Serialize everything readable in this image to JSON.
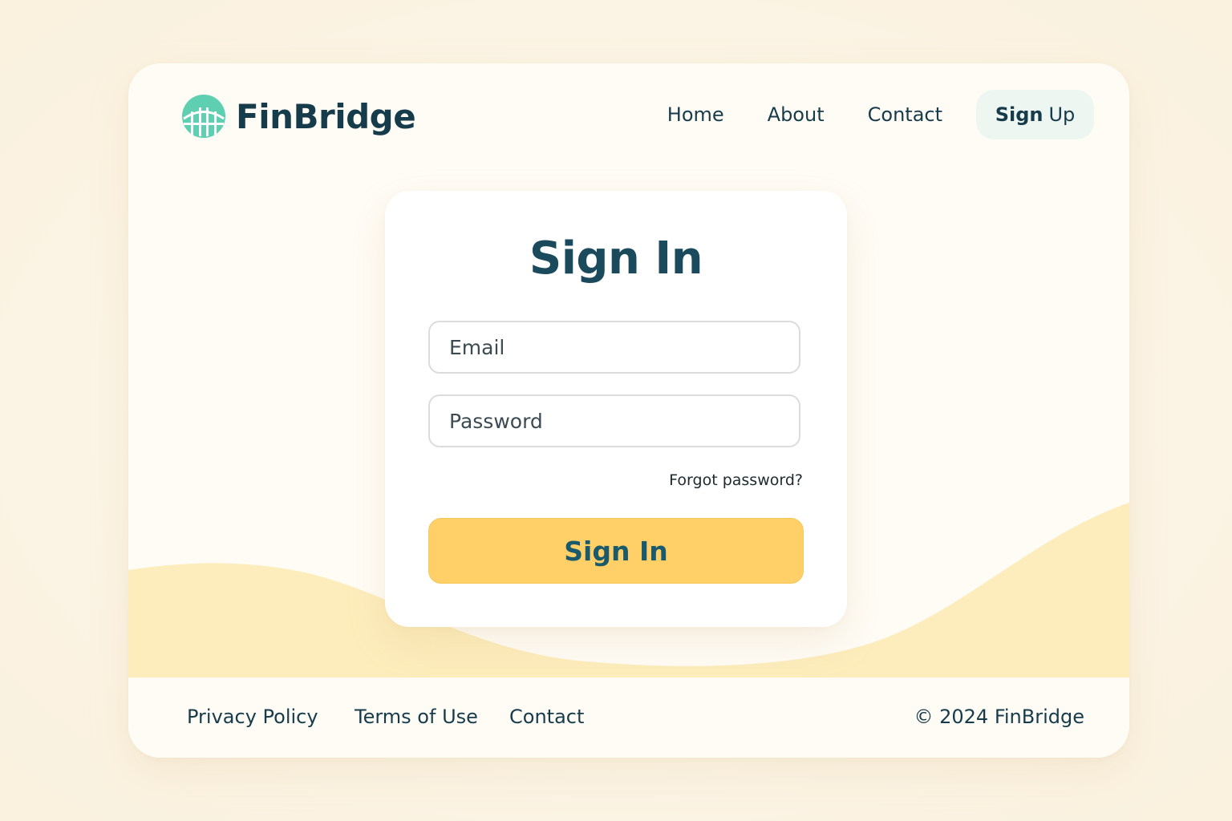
{
  "brand": {
    "name": "FinBridge",
    "logo_icon": "bridge-icon",
    "logo_color": "#5ecfb0",
    "text_color": "#163c4c"
  },
  "nav": {
    "items": [
      {
        "label": "Home"
      },
      {
        "label": "About"
      },
      {
        "label": "Contact"
      }
    ],
    "signup": {
      "bold": "Sign",
      "thin": "Up"
    }
  },
  "signin": {
    "title": "Sign In",
    "email_placeholder": "Email",
    "password_placeholder": "Password",
    "forgot_label": "Forgot password?",
    "submit_label": "Sign In",
    "submit_color": "#fed067"
  },
  "footer": {
    "links": [
      {
        "label": "Privacy Policy"
      },
      {
        "label": "Terms of Use"
      },
      {
        "label": "Contact"
      }
    ],
    "copyright": "© 2024 FinBridge"
  },
  "colors": {
    "page_background": "#fcf6ea",
    "wave": "#fdedbc",
    "accent": "#fed067"
  }
}
